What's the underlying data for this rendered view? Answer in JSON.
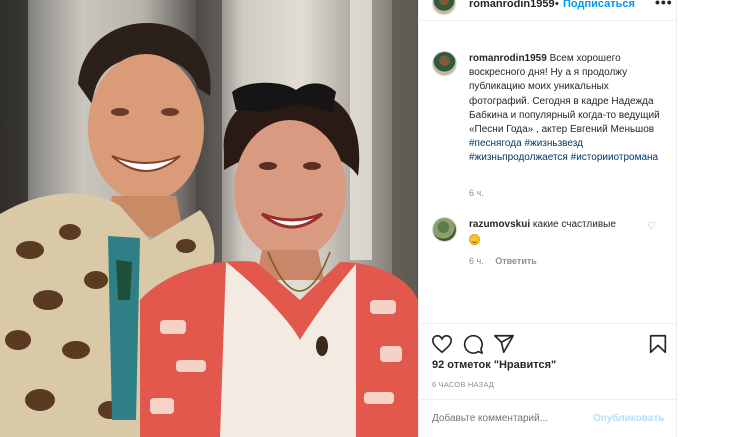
{
  "post": {
    "username": "romanrodin1959",
    "separator": "•",
    "follow_label": "Подписаться",
    "more_label": "•••",
    "caption": {
      "username": "romanrodin1959",
      "text": "Всем хорошего воскресного дня! Ну а я продолжу публикацию моих уникальных фотографий. Сегодня в кадре Надежда Бабкина и популярный когда-то ведущий «Песни Года» , актер Евгений Меньшов",
      "hashtags": [
        "#песнягода",
        "#жизньзвезд",
        "#жизньпродолжается",
        "#историиотромана"
      ],
      "time": "6 ч."
    },
    "comment": {
      "username": "razumovskui",
      "text": "какие счастливые",
      "emoji": "smiling-face",
      "time": "6 ч.",
      "reply_label": "Ответить"
    },
    "actions": {
      "like_icon": "heart-icon",
      "comment_icon": "comment-icon",
      "share_icon": "share-icon",
      "save_icon": "bookmark-icon"
    },
    "likes_label": "92 отметок \"Нравится\"",
    "posted_ago": "6 ЧАСОВ НАЗАД",
    "add_comment_placeholder": "Добавьте комментарий...",
    "publish_label": "Опубликовать"
  },
  "colors": {
    "link_blue": "#0095f6",
    "publish_disabled": "#b2dffc",
    "hashtag": "#00376b",
    "muted": "#8e8e8e"
  }
}
